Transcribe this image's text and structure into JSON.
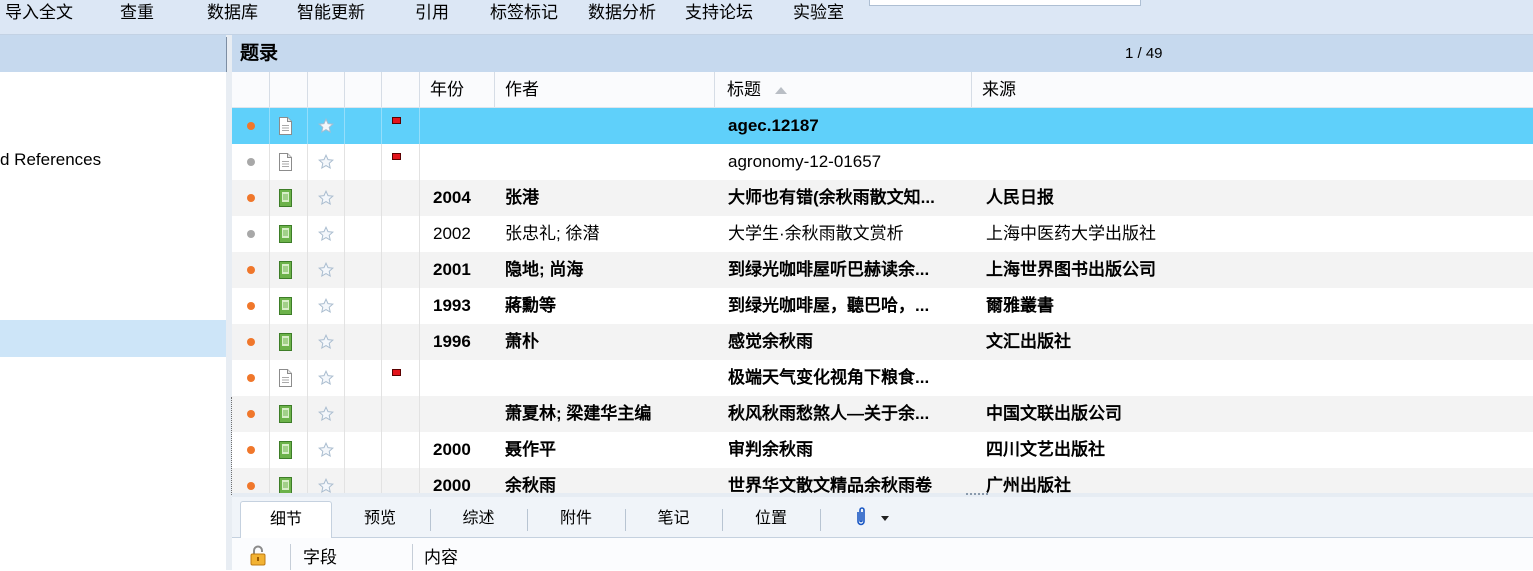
{
  "toolbar": {
    "items": [
      {
        "label": "导入全文"
      },
      {
        "label": "查重"
      },
      {
        "label": "数据库"
      },
      {
        "label": "智能更新"
      },
      {
        "label": "引用"
      },
      {
        "label": "标签标记"
      },
      {
        "label": "数据分析"
      },
      {
        "label": "支持论坛"
      },
      {
        "label": "实验室"
      }
    ]
  },
  "left_panel": {
    "items": [
      {
        "label": "d References"
      }
    ]
  },
  "main": {
    "title": "题录",
    "page_indicator": "1 / 49",
    "columns": {
      "year": "年份",
      "author": "作者",
      "title": "标题",
      "source": "来源"
    },
    "sort_icon": "sort-ascending-icon",
    "rows": [
      {
        "dot_color": "#f0772b",
        "icon": "document-icon",
        "flag_color": "#e3141c",
        "title": "agec.12187",
        "bold": true,
        "selected": true
      },
      {
        "dot_color": "#a8a8a8",
        "icon": "document-icon",
        "flag_color": "#e3141c",
        "title": "agronomy-12-01657",
        "bold": false,
        "selected": false
      },
      {
        "dot_color": "#f0772b",
        "icon": "book-icon",
        "year": "2004",
        "author": "张港",
        "title": "大师也有错(余秋雨散文知...",
        "source": "人民日报",
        "bold": true,
        "selected": false
      },
      {
        "dot_color": "#a8a8a8",
        "icon": "book-icon",
        "year": "2002",
        "author": "张忠礼; 徐潜",
        "title": "大学生·余秋雨散文赏析",
        "source": "上海中医药大学出版社",
        "bold": false,
        "selected": false
      },
      {
        "dot_color": "#f0772b",
        "icon": "book-icon",
        "year": "2001",
        "author": "隐地; 尚海",
        "title": "到绿光咖啡屋听巴赫读余...",
        "source": "上海世界图书出版公司",
        "bold": true,
        "selected": false
      },
      {
        "dot_color": "#f0772b",
        "icon": "book-icon",
        "year": "1993",
        "author": "蔣勳等",
        "title": "到绿光咖啡屋，聽巴哈，...",
        "source": "爾雅叢書",
        "bold": true,
        "selected": false
      },
      {
        "dot_color": "#f0772b",
        "icon": "book-icon",
        "year": "1996",
        "author": "萧朴",
        "title": "感觉余秋雨",
        "source": "文汇出版社",
        "bold": true,
        "selected": false
      },
      {
        "dot_color": "#f0772b",
        "icon": "document-icon",
        "flag_color": "#e3141c",
        "title": "极端天气变化视角下粮食...",
        "bold": true,
        "selected": false
      },
      {
        "dot_color": "#f0772b",
        "icon": "book-icon",
        "author": "萧夏林; 梁建华主编",
        "title": "秋风秋雨愁煞人—关于余...",
        "source": "中国文联出版公司",
        "bold": true,
        "selected": false
      },
      {
        "dot_color": "#f0772b",
        "icon": "book-icon",
        "year": "2000",
        "author": "聂作平",
        "title": "审判余秋雨",
        "source": "四川文艺出版社",
        "bold": true,
        "selected": false
      },
      {
        "dot_color": "#f0772b",
        "icon": "book-icon",
        "year": "2000",
        "author": "余秋雨",
        "title": "世界华文散文精品余秋雨卷",
        "source": "广州出版社",
        "bold": true,
        "selected": false
      }
    ]
  },
  "bottom_panel": {
    "tabs": [
      {
        "label": "细节",
        "active": true
      },
      {
        "label": "预览",
        "active": false
      },
      {
        "label": "综述",
        "active": false
      },
      {
        "label": "附件",
        "active": false
      },
      {
        "label": "笔记",
        "active": false
      },
      {
        "label": "位置",
        "active": false
      }
    ],
    "fields_header": {
      "field": "字段",
      "content": "内容"
    }
  },
  "colors": {
    "selected_row": "#5fd0fa",
    "header_bar": "#c6d9ee",
    "toolbar": "#dce7f5"
  }
}
